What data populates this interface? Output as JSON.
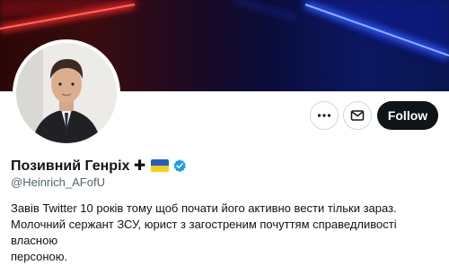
{
  "profile": {
    "display_name": "Позивний Генріх ✚",
    "handle": "@Heinrich_AFofU",
    "bio": [
      "Завів Twitter 10 років тому щоб почати його активно вести тільки зараз.",
      "Молочний сержант ЗСУ, юрист з загостреним почуттям справедливості власною",
      "персоною."
    ],
    "verified": true
  },
  "actions": {
    "more_icon": "more-horizontal-icon",
    "message_icon": "envelope-icon",
    "follow_label": "Follow"
  },
  "colors": {
    "follow_bg": "#0f1419",
    "verified": "#1d9bf0",
    "handle": "#536471",
    "flag_blue": "#1f5fc4",
    "flag_yellow": "#f7cf15"
  }
}
